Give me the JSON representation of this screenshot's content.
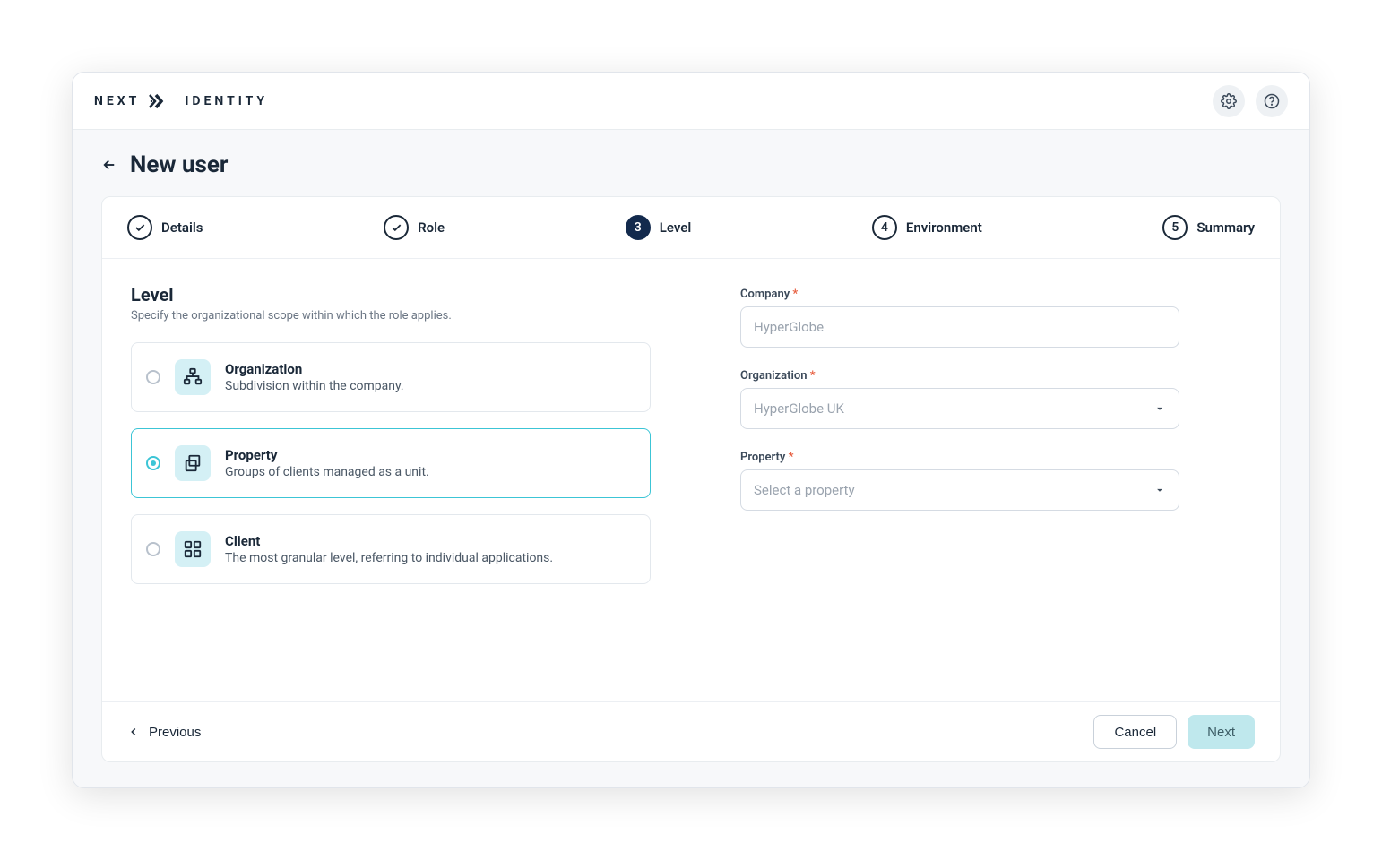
{
  "logo": {
    "left": "NEXT",
    "right": "IDENTITY"
  },
  "page": {
    "title": "New user"
  },
  "stepper": {
    "steps": [
      {
        "label": "Details"
      },
      {
        "label": "Role"
      },
      {
        "label": "Level",
        "num": "3"
      },
      {
        "label": "Environment",
        "num": "4"
      },
      {
        "label": "Summary",
        "num": "5"
      }
    ]
  },
  "section": {
    "title": "Level",
    "desc": "Specify the organizational scope within which the role applies."
  },
  "options": {
    "organization": {
      "title": "Organization",
      "desc": "Subdivision within the company."
    },
    "property": {
      "title": "Property",
      "desc": "Groups of clients managed as a unit."
    },
    "client": {
      "title": "Client",
      "desc": "The most granular level, referring to individual applications."
    }
  },
  "form": {
    "company": {
      "label": "Company",
      "value": "HyperGlobe"
    },
    "organization": {
      "label": "Organization",
      "value": "HyperGlobe UK"
    },
    "property": {
      "label": "Property",
      "placeholder": "Select a property"
    }
  },
  "footer": {
    "previous": "Previous",
    "cancel": "Cancel",
    "next": "Next"
  }
}
